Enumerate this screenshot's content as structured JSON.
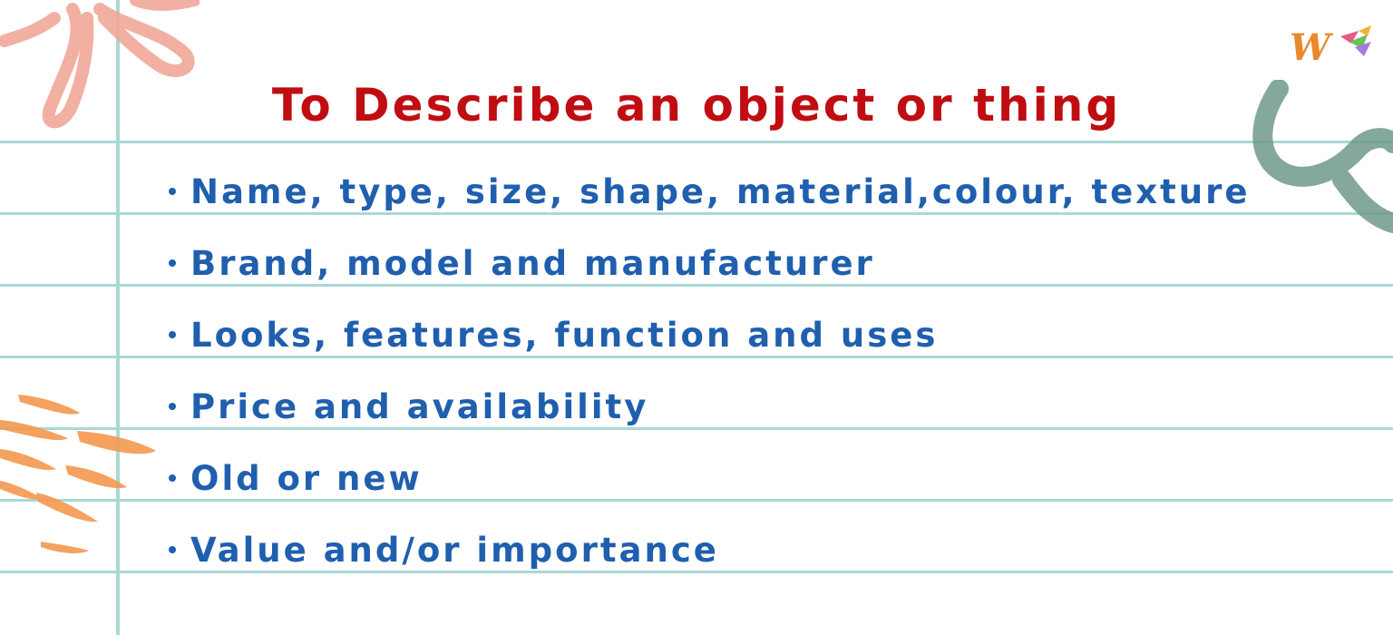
{
  "title": "To Describe an object or thing",
  "bullets": [
    "Name, type, size, shape, material,colour, texture",
    "Brand, model and manufacturer",
    "Looks, features, function and uses",
    "Price and availability",
    "Old or new",
    "Value and/or importance"
  ],
  "colors": {
    "title": "#c00d12",
    "bullet_text": "#1f5fae",
    "ruled_line": "#a9d8d6",
    "pink_flower": "#f0a898",
    "orange_strokes": "#f4994f",
    "green_swirl": "#6f9a8a"
  },
  "icons": {
    "logo": "w-logo-icon",
    "top_left": "pink-flower-decoration",
    "left": "orange-brush-strokes-decoration",
    "top_right": "green-swirl-decoration"
  }
}
